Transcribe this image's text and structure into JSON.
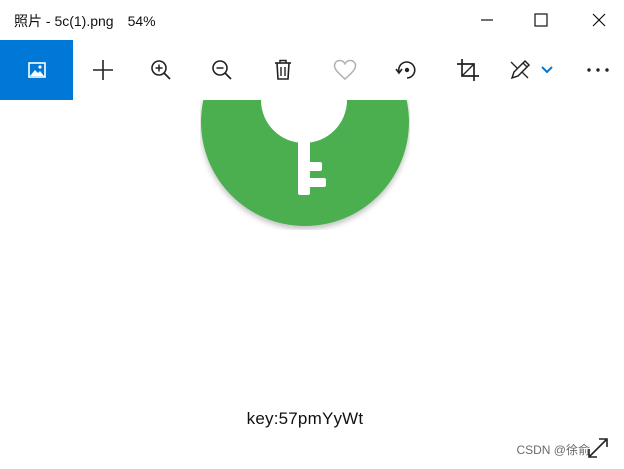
{
  "window": {
    "title": "照片 - 5c(1).png",
    "zoom": "54%"
  },
  "toolbar": {
    "items": [
      {
        "name": "photo-view",
        "icon": "image-icon",
        "active": true
      },
      {
        "name": "add",
        "icon": "plus-icon"
      },
      {
        "name": "zoom-in",
        "icon": "zoom-in-icon"
      },
      {
        "name": "zoom-out",
        "icon": "zoom-out-icon"
      },
      {
        "name": "delete",
        "icon": "trash-icon"
      },
      {
        "name": "favorite",
        "icon": "heart-icon"
      },
      {
        "name": "rotate",
        "icon": "rotate-icon"
      },
      {
        "name": "crop",
        "icon": "crop-icon"
      },
      {
        "name": "edit",
        "icon": "pen-icon"
      },
      {
        "name": "more",
        "icon": "more-icon"
      }
    ]
  },
  "image": {
    "caption": "key:57pmYyWt",
    "colors": {
      "circle": "#4caf50",
      "key": "#ffffff"
    }
  },
  "watermark": "CSDN @徐俞",
  "colors": {
    "accent": "#0078d7",
    "icon": "#222222",
    "favorite_disabled": "#b0b0b0"
  }
}
